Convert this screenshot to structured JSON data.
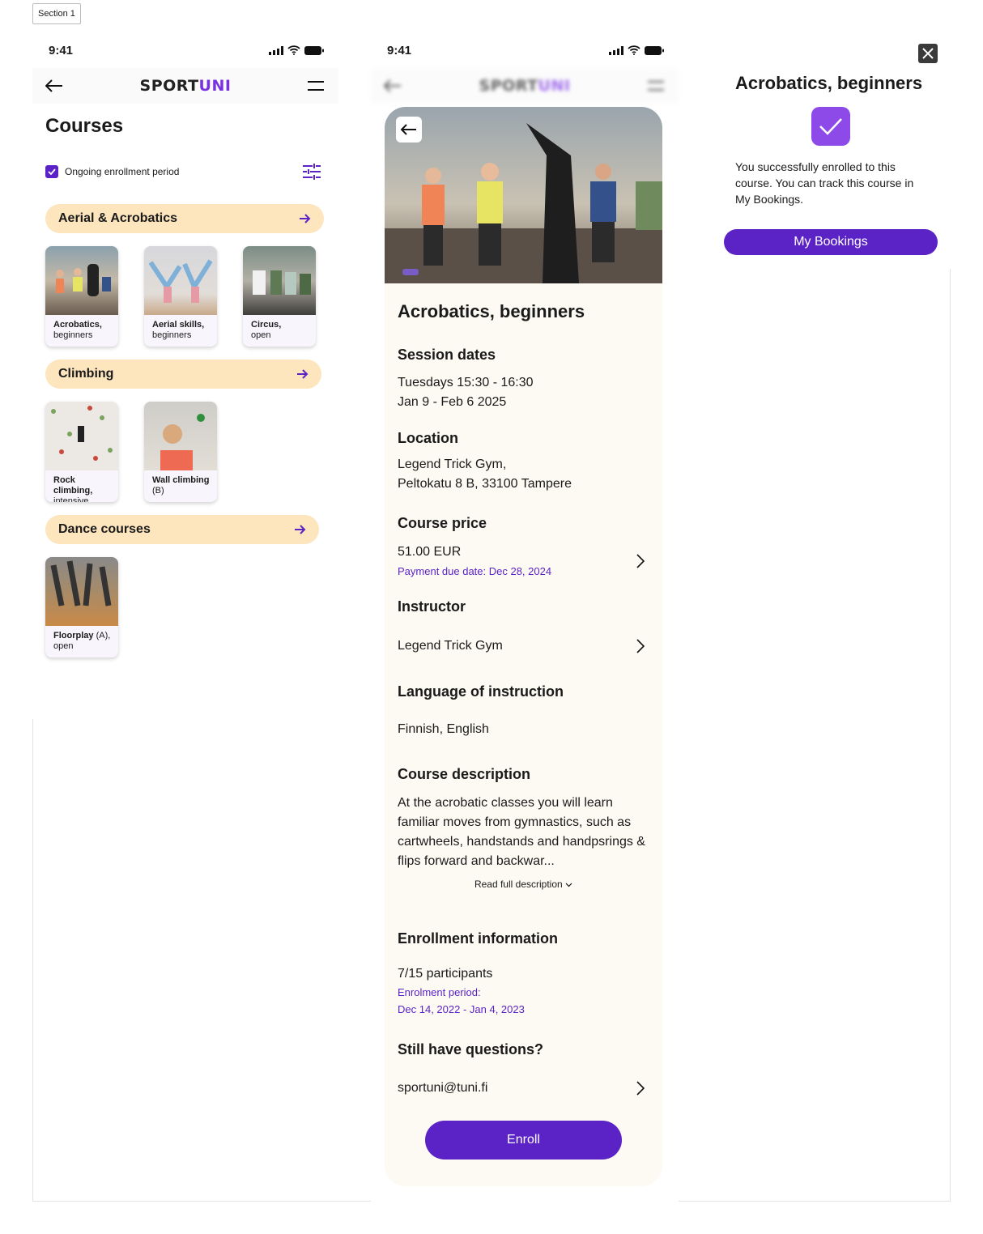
{
  "section_label": "Section 1",
  "status": {
    "time": "9:41"
  },
  "brand": {
    "part1": "SPORT",
    "part2": "UNI"
  },
  "courses_screen": {
    "title": "Courses",
    "filter_label": "Ongoing enrollment period",
    "categories": [
      {
        "label": "Aerial & Acrobatics",
        "cards": [
          {
            "line1": "Acrobatics,",
            "line2": "beginners"
          },
          {
            "line1": "Aerial skills,",
            "line2": "beginners"
          },
          {
            "line1": "Circus,",
            "line2": "open"
          }
        ]
      },
      {
        "label": "Climbing",
        "cards": [
          {
            "line1": "Rock climbing,",
            "line2": "intensive"
          },
          {
            "line1": "Wall climbing",
            "line2": "(B)"
          }
        ]
      },
      {
        "label": "Dance courses",
        "cards": [
          {
            "line1": "Floorplay",
            "line1b": " (A),",
            "line2": "open"
          }
        ]
      }
    ]
  },
  "detail_screen": {
    "title": "Acrobatics, beginners",
    "session_heading": "Session dates",
    "session_line1": "Tuesdays 15:30 - 16:30",
    "session_line2": "Jan 9 - Feb 6 2025",
    "location_heading": "Location",
    "location_line1": "Legend Trick Gym,",
    "location_line2": "Peltokatu 8 B, 33100 Tampere",
    "price_heading": "Course price",
    "price": "51.00 EUR",
    "payment_due": "Payment due date: Dec 28, 2024",
    "instructor_heading": "Instructor",
    "instructor": "Legend Trick Gym",
    "language_heading": "Language of instruction",
    "language": "Finnish, English",
    "description_heading": "Course description",
    "description": "At the acrobatic classes you will learn familiar moves from gymnastics, such as cartwheels, handstands and handpsrings & flips forward and backwar...",
    "read_more": "Read full description",
    "enrollment_heading": "Enrollment information",
    "participants": "7/15 participants",
    "enrol_period_label": "Enrolment period:",
    "enrol_period_dates": "Dec 14, 2022 - Jan 4, 2023",
    "questions_heading": "Still have questions?",
    "contact_email": "sportuni@tuni.fi",
    "enroll_button": "Enroll"
  },
  "modal": {
    "title": "Acrobatics, beginners",
    "message": "You successfully  enrolled to this course. You can track this course in My Bookings.",
    "button": "My Bookings"
  },
  "colors": {
    "primary": "#5b22c6",
    "accent": "#8e4ae8",
    "category_bg": "#fde5bd",
    "detail_bg": "#fdfaf3"
  }
}
